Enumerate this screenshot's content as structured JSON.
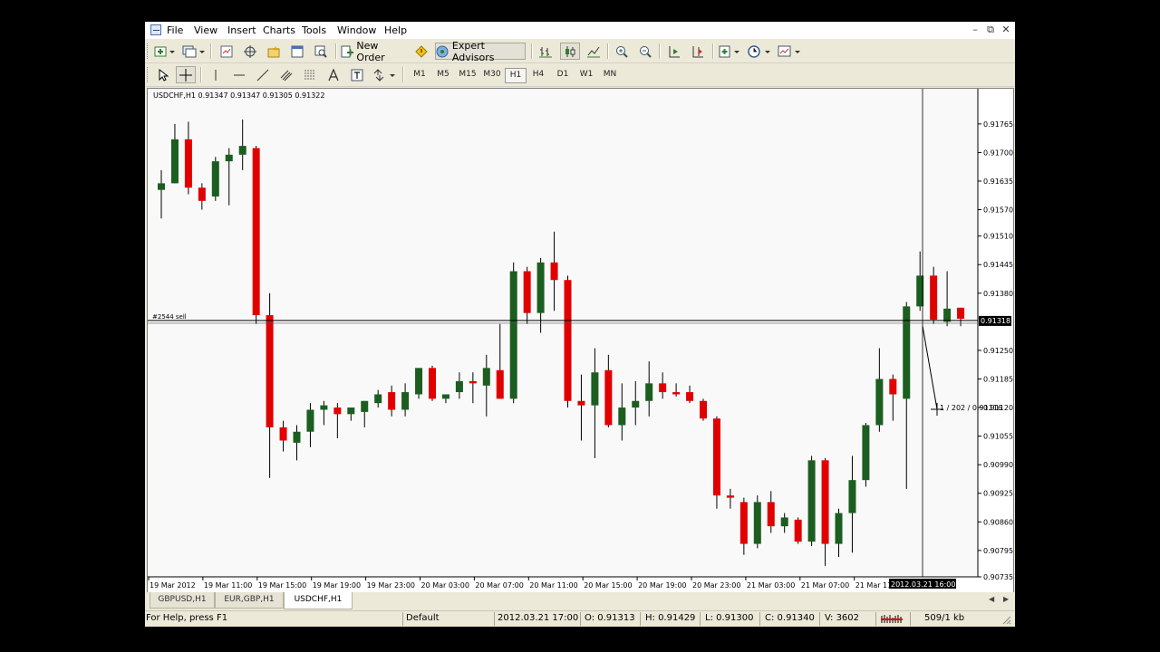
{
  "menu": [
    "File",
    "View",
    "Insert",
    "Charts",
    "Tools",
    "Window",
    "Help"
  ],
  "window_controls": [
    "–",
    "⧉",
    "✕"
  ],
  "toolbar1": {
    "new_order": "New Order",
    "expert_advisors": "Expert Advisors"
  },
  "timeframes": [
    "M1",
    "M5",
    "M15",
    "M30",
    "H1",
    "H4",
    "D1",
    "W1",
    "MN"
  ],
  "active_timeframe": "H1",
  "chart": {
    "symbol_label": "USDCHF,H1  0.91347 0.91347 0.91305 0.91322",
    "order_label": "#2544 sell",
    "current_price": "0.91318",
    "crosshair_time": "2012.03.21 16:00",
    "crosshair_readout": "1 / 202 / 0.91116",
    "price_labels": [
      "0.91765",
      "0.91700",
      "0.91635",
      "0.91570",
      "0.91510",
      "0.91445",
      "0.91380",
      "0.91250",
      "0.91185",
      "0.91120",
      "0.91055",
      "0.90990",
      "0.90925",
      "0.90860",
      "0.90795",
      "0.90735"
    ],
    "time_labels": [
      "19 Mar 2012",
      "19 Mar 11:00",
      "19 Mar 15:00",
      "19 Mar 19:00",
      "19 Mar 23:00",
      "20 Mar 03:00",
      "20 Mar 07:00",
      "20 Mar 11:00",
      "20 Mar 15:00",
      "20 Mar 19:00",
      "20 Mar 23:00",
      "21 Mar 03:00",
      "21 Mar 07:00",
      "21 Mar 11:"
    ],
    "colors": {
      "bull": "#1b5e20",
      "bear": "#e00000",
      "wick": "#000000"
    }
  },
  "chart_data": {
    "type": "candlestick",
    "symbol": "USDCHF",
    "timeframe": "H1",
    "ylim": [
      0.90735,
      0.91845
    ],
    "candles": [
      {
        "o": 0.91615,
        "h": 0.9166,
        "l": 0.9155,
        "c": 0.9163
      },
      {
        "o": 0.9163,
        "h": 0.91765,
        "l": 0.9163,
        "c": 0.9173
      },
      {
        "o": 0.9173,
        "h": 0.9177,
        "l": 0.91605,
        "c": 0.9162
      },
      {
        "o": 0.9162,
        "h": 0.9163,
        "l": 0.9157,
        "c": 0.9159
      },
      {
        "o": 0.916,
        "h": 0.9169,
        "l": 0.9159,
        "c": 0.9168
      },
      {
        "o": 0.9168,
        "h": 0.9171,
        "l": 0.9158,
        "c": 0.91695
      },
      {
        "o": 0.91695,
        "h": 0.91775,
        "l": 0.9166,
        "c": 0.91715
      },
      {
        "o": 0.9171,
        "h": 0.91715,
        "l": 0.9131,
        "c": 0.9133
      },
      {
        "o": 0.9133,
        "h": 0.9138,
        "l": 0.9096,
        "c": 0.91075
      },
      {
        "o": 0.91075,
        "h": 0.9109,
        "l": 0.9102,
        "c": 0.91045
      },
      {
        "o": 0.9104,
        "h": 0.9108,
        "l": 0.91,
        "c": 0.91065
      },
      {
        "o": 0.91065,
        "h": 0.9113,
        "l": 0.9103,
        "c": 0.91115
      },
      {
        "o": 0.91115,
        "h": 0.91135,
        "l": 0.9108,
        "c": 0.91125
      },
      {
        "o": 0.9112,
        "h": 0.9113,
        "l": 0.9105,
        "c": 0.91105
      },
      {
        "o": 0.91105,
        "h": 0.9112,
        "l": 0.9109,
        "c": 0.9112
      },
      {
        "o": 0.9111,
        "h": 0.91135,
        "l": 0.91075,
        "c": 0.91135
      },
      {
        "o": 0.9113,
        "h": 0.9116,
        "l": 0.9112,
        "c": 0.9115
      },
      {
        "o": 0.91155,
        "h": 0.9117,
        "l": 0.911,
        "c": 0.91115
      },
      {
        "o": 0.91115,
        "h": 0.91175,
        "l": 0.911,
        "c": 0.91155
      },
      {
        "o": 0.9115,
        "h": 0.9121,
        "l": 0.9114,
        "c": 0.9121
      },
      {
        "o": 0.9121,
        "h": 0.91215,
        "l": 0.91135,
        "c": 0.9114
      },
      {
        "o": 0.9114,
        "h": 0.9115,
        "l": 0.9113,
        "c": 0.9115
      },
      {
        "o": 0.91155,
        "h": 0.912,
        "l": 0.9114,
        "c": 0.9118
      },
      {
        "o": 0.9118,
        "h": 0.912,
        "l": 0.9113,
        "c": 0.91175
      },
      {
        "o": 0.9117,
        "h": 0.9124,
        "l": 0.911,
        "c": 0.9121
      },
      {
        "o": 0.91205,
        "h": 0.9131,
        "l": 0.9114,
        "c": 0.9114
      },
      {
        "o": 0.9114,
        "h": 0.9145,
        "l": 0.9113,
        "c": 0.9143
      },
      {
        "o": 0.9143,
        "h": 0.9144,
        "l": 0.9131,
        "c": 0.91335
      },
      {
        "o": 0.91335,
        "h": 0.9146,
        "l": 0.9129,
        "c": 0.9145
      },
      {
        "o": 0.9145,
        "h": 0.9152,
        "l": 0.9134,
        "c": 0.9141
      },
      {
        "o": 0.9141,
        "h": 0.9142,
        "l": 0.9112,
        "c": 0.91135
      },
      {
        "o": 0.91135,
        "h": 0.91195,
        "l": 0.91045,
        "c": 0.91125
      },
      {
        "o": 0.91125,
        "h": 0.91255,
        "l": 0.91005,
        "c": 0.912
      },
      {
        "o": 0.91205,
        "h": 0.9124,
        "l": 0.91075,
        "c": 0.9108
      },
      {
        "o": 0.9108,
        "h": 0.91175,
        "l": 0.91045,
        "c": 0.9112
      },
      {
        "o": 0.9112,
        "h": 0.9118,
        "l": 0.9108,
        "c": 0.91135
      },
      {
        "o": 0.91135,
        "h": 0.91225,
        "l": 0.911,
        "c": 0.91175
      },
      {
        "o": 0.91175,
        "h": 0.912,
        "l": 0.9114,
        "c": 0.91155
      },
      {
        "o": 0.91155,
        "h": 0.91175,
        "l": 0.91145,
        "c": 0.9115
      },
      {
        "o": 0.91155,
        "h": 0.9117,
        "l": 0.9113,
        "c": 0.91135
      },
      {
        "o": 0.91135,
        "h": 0.9114,
        "l": 0.9109,
        "c": 0.91095
      },
      {
        "o": 0.91095,
        "h": 0.911,
        "l": 0.9089,
        "c": 0.9092
      },
      {
        "o": 0.9092,
        "h": 0.90935,
        "l": 0.9089,
        "c": 0.90915
      },
      {
        "o": 0.90905,
        "h": 0.90915,
        "l": 0.90785,
        "c": 0.9081
      },
      {
        "o": 0.9081,
        "h": 0.9092,
        "l": 0.908,
        "c": 0.90905
      },
      {
        "o": 0.90905,
        "h": 0.9093,
        "l": 0.90835,
        "c": 0.9085
      },
      {
        "o": 0.9085,
        "h": 0.9088,
        "l": 0.90835,
        "c": 0.9087
      },
      {
        "o": 0.90865,
        "h": 0.9087,
        "l": 0.9081,
        "c": 0.90815
      },
      {
        "o": 0.90815,
        "h": 0.9101,
        "l": 0.90805,
        "c": 0.91
      },
      {
        "o": 0.91,
        "h": 0.91005,
        "l": 0.9076,
        "c": 0.9081
      },
      {
        "o": 0.9081,
        "h": 0.9089,
        "l": 0.9078,
        "c": 0.9088
      },
      {
        "o": 0.9088,
        "h": 0.9101,
        "l": 0.9079,
        "c": 0.90955
      },
      {
        "o": 0.90955,
        "h": 0.91085,
        "l": 0.9094,
        "c": 0.9108
      },
      {
        "o": 0.9108,
        "h": 0.91255,
        "l": 0.91065,
        "c": 0.91185
      },
      {
        "o": 0.91185,
        "h": 0.91195,
        "l": 0.9109,
        "c": 0.9115
      },
      {
        "o": 0.9114,
        "h": 0.9136,
        "l": 0.90935,
        "c": 0.9135
      },
      {
        "o": 0.9135,
        "h": 0.91475,
        "l": 0.9134,
        "c": 0.9142
      },
      {
        "o": 0.9142,
        "h": 0.9144,
        "l": 0.9131,
        "c": 0.9132
      },
      {
        "o": 0.91315,
        "h": 0.9143,
        "l": 0.91305,
        "c": 0.91345
      },
      {
        "o": 0.91347,
        "h": 0.91347,
        "l": 0.91305,
        "c": 0.91322
      }
    ]
  },
  "tabs": [
    "GBPUSD,H1",
    "EUR,GBP,H1",
    "USDCHF,H1"
  ],
  "active_tab": "USDCHF,H1",
  "status": {
    "help": "For Help, press F1",
    "profile": "Default",
    "datetime": "2012.03.21 17:00",
    "open": "O: 0.91313",
    "high": "H: 0.91429",
    "low": "L: 0.91300",
    "close": "C: 0.91340",
    "volume": "V: 3602",
    "traffic": "509/1 kb"
  }
}
